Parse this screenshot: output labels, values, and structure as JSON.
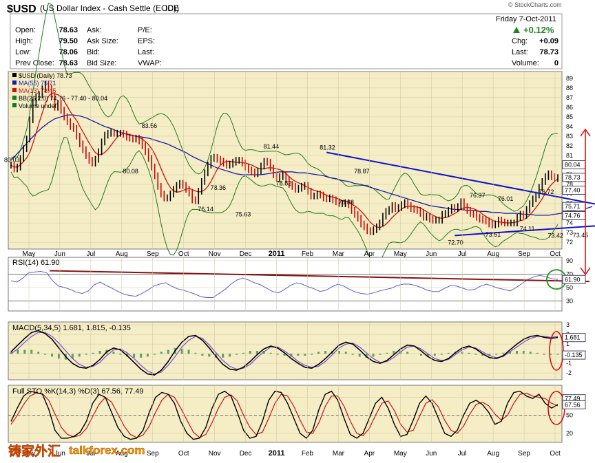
{
  "header": {
    "symbol": "$USD",
    "name": "(US Dollar Index - Cash Settle (EOD))",
    "exchange": "ICE",
    "copyright": "© StockCharts.com",
    "date": "Friday  7-Oct-2011",
    "change_pct": "+0.12%"
  },
  "quote_left": [
    {
      "label": "Open:",
      "value": "78.63"
    },
    {
      "label": "High:",
      "value": "79.50"
    },
    {
      "label": "Low:",
      "value": "78.06"
    },
    {
      "label": "Prev Close:",
      "value": "78.63"
    }
  ],
  "quote_mid": [
    {
      "label": "Ask:",
      "value": ""
    },
    {
      "label": "Ask Size:",
      "value": ""
    },
    {
      "label": "Bid:",
      "value": ""
    },
    {
      "label": "Bid Size:",
      "value": ""
    }
  ],
  "quote_mid2": [
    {
      "label": "P/E:",
      "value": ""
    },
    {
      "label": "EPS:",
      "value": ""
    },
    {
      "label": "Last:",
      "value": ""
    },
    {
      "label": "VWAP:",
      "value": ""
    }
  ],
  "quote_right": [
    {
      "label": "Chg:",
      "value": "+0.09"
    },
    {
      "label": "Last:",
      "value": "78.73"
    },
    {
      "label": "Volume:",
      "value": "0"
    }
  ],
  "watermark": {
    "cn": "铸家外汇",
    "en": "talkforex.com"
  },
  "colors": {
    "panel_bg": "#f4edc6",
    "price_bar": "#000000",
    "ma55": "#1a1aa8",
    "ma13": "#cc1010",
    "bb": "#1a7a1a",
    "trendline": "#1010cc",
    "annotation": "#e00000",
    "rsi_line": "#5a5ad0",
    "rsi_trend": "#8b1010",
    "rsi_circle": "#2a9a2a",
    "macd_line": "#000000",
    "macd_signal": "#7a4ad0",
    "macd_hist": "#5aa05a",
    "sto_k": "#000000",
    "sto_d": "#cc1010"
  },
  "chart_data": [
    {
      "type": "line",
      "panel": "price",
      "legend": [
        "$USD (Daily) 78.73",
        "MA(55) 75.71",
        "MA(13) 78.45",
        "BB(26,2.0) 74.76 - 77.40 - 80.04",
        "Volume undef"
      ],
      "x_labels": [
        "May",
        "Jun",
        "Jul",
        "Aug",
        "Sep",
        "Oct",
        "Nov",
        "Dec",
        "2011",
        "Feb",
        "Mar",
        "Apr",
        "May",
        "Jun",
        "Jul",
        "Aug",
        "Sep",
        "Oct"
      ],
      "y_ticks": [
        72,
        73,
        74,
        75,
        76,
        77,
        78,
        79,
        80,
        81,
        82,
        83,
        84,
        85,
        86,
        87,
        88,
        89
      ],
      "ylim": [
        71.3,
        89.7
      ],
      "right_value_tags": [
        "80.04",
        "78.73",
        "77.40",
        "75.71",
        "74.76"
      ],
      "annotations": [
        {
          "label": "80.03",
          "x": 0,
          "y": 80.03
        },
        {
          "label": "83.56",
          "x": 44,
          "y": 83.56
        },
        {
          "label": "80.08",
          "x": 38,
          "y": 80.08
        },
        {
          "label": "78.36",
          "x": 66,
          "y": 78.36
        },
        {
          "label": "76.14",
          "x": 62,
          "y": 76.14
        },
        {
          "label": "75.63",
          "x": 74,
          "y": 75.63
        },
        {
          "label": "81.44",
          "x": 83,
          "y": 81.44
        },
        {
          "label": "78.82",
          "x": 87,
          "y": 78.82
        },
        {
          "label": "81.32",
          "x": 101,
          "y": 81.32
        },
        {
          "label": "78.87",
          "x": 112,
          "y": 78.87
        },
        {
          "label": "76.88",
          "x": 107,
          "y": 76.88
        },
        {
          "label": "76.37",
          "x": 149,
          "y": 76.37
        },
        {
          "label": "76.01",
          "x": 158,
          "y": 76.01
        },
        {
          "label": "76.72",
          "x": 171,
          "y": 76.72
        },
        {
          "label": "75.45",
          "x": 181,
          "y": 75.45
        },
        {
          "label": "74.11",
          "x": 165,
          "y": 74.11
        },
        {
          "label": "73.51",
          "x": 154,
          "y": 73.51
        },
        {
          "label": "73.42",
          "x": 174,
          "y": 73.42
        },
        {
          "label": "73.45",
          "x": 182,
          "y": 73.45
        },
        {
          "label": "72.70",
          "x": 142,
          "y": 72.7
        },
        {
          "label": "79.8",
          "x": 198,
          "y": 79.8
        }
      ],
      "trendlines": [
        {
          "from": [
            101,
            81.32
          ],
          "to": [
            213,
            74.3
          ]
        },
        {
          "from": [
            142,
            72.7
          ],
          "to": [
            213,
            74.3
          ]
        }
      ],
      "close": [
        80.0,
        79.6,
        79.8,
        80.7,
        81.7,
        82.7,
        84.7,
        86.5,
        87.1,
        87.3,
        87.9,
        88.4,
        88.0,
        87.1,
        86.0,
        86.4,
        85.7,
        85.0,
        84.5,
        84.0,
        83.8,
        83.0,
        82.2,
        81.6,
        81.0,
        80.5,
        80.2,
        80.6,
        81.4,
        82.4,
        83.1,
        83.3,
        83.4,
        83.3,
        83.3,
        83.3,
        83.2,
        82.9,
        82.8,
        82.7,
        82.8,
        82.5,
        82.0,
        81.4,
        80.7,
        79.8,
        78.9,
        77.8,
        77.0,
        76.6,
        76.6,
        77.0,
        77.5,
        77.9,
        78.1,
        77.9,
        77.5,
        77.1,
        76.4,
        76.3,
        77.3,
        78.3,
        79.2,
        80.0,
        80.7,
        80.8,
        80.6,
        80.4,
        80.2,
        80.0,
        80.1,
        80.3,
        80.5,
        80.5,
        80.2,
        79.8,
        79.5,
        79.3,
        79.1,
        79.4,
        79.9,
        80.4,
        80.3,
        79.7,
        79.0,
        78.6,
        78.8,
        79.0,
        78.5,
        78.0,
        77.8,
        77.5,
        77.6,
        77.8,
        77.9,
        77.3,
        76.8,
        76.8,
        77.0,
        76.9,
        76.6,
        76.5,
        76.6,
        76.4,
        76.2,
        76.0,
        76.0,
        76.1,
        75.9,
        75.3,
        74.9,
        74.5,
        73.9,
        73.6,
        73.2,
        73.1,
        73.3,
        73.6,
        74.0,
        74.7,
        75.2,
        75.4,
        75.8,
        75.5,
        75.6,
        75.9,
        76.1,
        75.8,
        75.5,
        75.4,
        75.3,
        75.0,
        74.6,
        74.7,
        74.4,
        74.3,
        74.3,
        74.3,
        74.9,
        75.0,
        75.3,
        75.6,
        75.5,
        75.7,
        76.2,
        75.7,
        75.3,
        75.0,
        74.9,
        74.6,
        74.4,
        74.3,
        74.2,
        73.9,
        73.8,
        73.9,
        74.3,
        74.1,
        74.0,
        74.0,
        74.0,
        74.0,
        74.6,
        74.9,
        74.8,
        75.4,
        76.0,
        76.5,
        76.9,
        77.7,
        78.3,
        78.8,
        79.1,
        78.8,
        78.6,
        78.7
      ],
      "ma55": [
        80.5,
        81.2,
        81.9,
        82.6,
        83.3,
        83.9,
        84.4,
        84.8,
        85.0,
        85.2,
        85.2,
        85.1,
        84.9,
        84.6,
        84.3,
        84.0,
        83.8,
        83.5,
        83.3,
        83.1,
        83.0,
        82.9,
        82.8,
        82.6,
        82.4,
        82.2,
        81.9,
        81.6,
        81.3,
        80.9,
        80.6,
        80.3,
        80.0,
        79.7,
        79.5,
        79.3,
        79.1,
        79.0,
        79.0,
        79.0,
        79.0,
        79.1,
        79.2,
        79.3,
        79.3,
        79.3,
        79.2,
        79.2,
        79.1,
        79.0,
        78.9,
        78.7,
        78.6,
        78.4,
        78.3,
        78.1,
        78.0,
        77.8,
        77.6,
        77.4,
        77.2,
        77.0,
        76.8,
        76.6,
        76.4,
        76.2,
        76.0,
        75.8,
        75.7,
        75.6,
        75.5,
        75.4,
        75.4,
        75.3,
        75.3,
        75.2,
        75.2,
        75.1,
        75.1,
        75.0,
        75.0,
        75.0,
        74.9,
        74.9,
        74.8,
        74.8,
        74.8,
        74.9,
        75.0,
        75.1,
        75.2,
        75.4,
        75.5,
        75.7
      ],
      "sample_every": 2
    },
    {
      "type": "line",
      "panel": "rsi",
      "legend": "RSI(14) 61.90",
      "y_ticks": [
        30,
        50,
        70,
        90
      ],
      "ylim": [
        15,
        95
      ],
      "right_value_tag": "61.90",
      "values": [
        60,
        58,
        64,
        72,
        73,
        74,
        72,
        60,
        52,
        50,
        47,
        43,
        41,
        45,
        54,
        58,
        53,
        49,
        44,
        40,
        38,
        37,
        41,
        46,
        52,
        55,
        57,
        52,
        48,
        46,
        43,
        40,
        36,
        35,
        35,
        41,
        47,
        55,
        61,
        64,
        61,
        57,
        54,
        49,
        44,
        42,
        47,
        53,
        57,
        55,
        51,
        48,
        44,
        46,
        51,
        55,
        52,
        47,
        43,
        41,
        40,
        42,
        45,
        47,
        49,
        53,
        55,
        55,
        53,
        50,
        46,
        44,
        44,
        49,
        53,
        52,
        49,
        46,
        47,
        52,
        55,
        52,
        49,
        47,
        45,
        50,
        56,
        62,
        66,
        68,
        66,
        63,
        62
      ]
    },
    {
      "type": "line",
      "panel": "macd",
      "legend": "MACD(5,34,5) 1.681, 1.815, -0.135",
      "y_ticks": [
        -2,
        -1,
        0,
        1,
        2,
        3
      ],
      "ylim": [
        -2.7,
        3.3
      ],
      "right_value_tags": [
        "1.681",
        "-0.135"
      ],
      "macd": [
        0.2,
        0.9,
        1.6,
        2.2,
        2.4,
        2.1,
        1.5,
        0.6,
        -0.3,
        -1.0,
        -1.4,
        -1.5,
        -1.2,
        -0.6,
        0.2,
        0.6,
        0.4,
        -0.2,
        -0.9,
        -1.6,
        -2.1,
        -2.2,
        -1.7,
        -0.8,
        0.3,
        1.2,
        1.8,
        1.9,
        1.4,
        0.6,
        -0.3,
        -1.1,
        -1.6,
        -1.7,
        -1.4,
        -0.8,
        -0.1,
        0.5,
        0.8,
        0.6,
        0.1,
        -0.5,
        -1.0,
        -1.4,
        -1.5,
        -1.1,
        -0.5,
        0.2,
        0.9,
        1.2,
        1.0,
        0.4,
        -0.3,
        -0.8,
        -1.0,
        -0.7,
        -0.1,
        0.5,
        0.9,
        0.8,
        0.3,
        -0.3,
        -0.7,
        -0.8,
        -0.5,
        0.1,
        0.6,
        0.8,
        0.5,
        0.0,
        -0.4,
        -0.5,
        -0.2,
        0.4,
        1.0,
        1.5,
        1.8,
        1.9,
        1.7,
        1.6,
        1.7
      ],
      "signal": [
        0.0,
        0.5,
        1.2,
        1.8,
        2.2,
        2.2,
        1.8,
        1.1,
        0.3,
        -0.5,
        -1.1,
        -1.4,
        -1.3,
        -0.9,
        -0.2,
        0.4,
        0.5,
        0.1,
        -0.5,
        -1.2,
        -1.8,
        -2.1,
        -1.9,
        -1.2,
        -0.3,
        0.7,
        1.4,
        1.8,
        1.6,
        0.9,
        0.1,
        -0.7,
        -1.3,
        -1.6,
        -1.5,
        -1.1,
        -0.4,
        0.2,
        0.7,
        0.7,
        0.3,
        -0.2,
        -0.8,
        -1.2,
        -1.4,
        -1.3,
        -0.8,
        -0.1,
        0.6,
        1.0,
        1.1,
        0.7,
        0.1,
        -0.5,
        -0.9,
        -0.8,
        -0.4,
        0.2,
        0.7,
        0.8,
        0.5,
        0.0,
        -0.5,
        -0.7,
        -0.6,
        -0.1,
        0.4,
        0.7,
        0.6,
        0.2,
        -0.2,
        -0.4,
        -0.3,
        0.2,
        0.7,
        1.2,
        1.6,
        1.8,
        1.8,
        1.7,
        1.8
      ]
    },
    {
      "type": "line",
      "panel": "stochastic",
      "legend": "Full STO %K(14,3) %D(3) 67.56, 77.49",
      "y_ticks": [
        20,
        50,
        80
      ],
      "ylim": [
        5,
        100
      ],
      "right_value_tags": [
        "77.49",
        "67.56"
      ],
      "k": [
        40,
        62,
        82,
        90,
        88,
        85,
        60,
        25,
        12,
        12,
        15,
        22,
        40,
        70,
        85,
        80,
        55,
        30,
        15,
        10,
        12,
        25,
        55,
        80,
        88,
        85,
        70,
        40,
        20,
        10,
        12,
        30,
        62,
        85,
        90,
        82,
        55,
        25,
        12,
        15,
        40,
        75,
        90,
        88,
        70,
        45,
        20,
        12,
        25,
        60,
        85,
        90,
        75,
        45,
        18,
        12,
        20,
        45,
        70,
        80,
        62,
        35,
        15,
        18,
        42,
        70,
        82,
        70,
        45,
        20,
        15,
        25,
        50,
        70,
        75,
        68,
        55,
        35,
        40,
        70,
        88,
        90,
        82,
        78,
        85,
        70,
        62,
        68
      ],
      "d": [
        35,
        50,
        68,
        82,
        87,
        86,
        75,
        52,
        30,
        18,
        14,
        17,
        28,
        48,
        68,
        80,
        72,
        52,
        32,
        18,
        13,
        17,
        32,
        55,
        75,
        85,
        80,
        62,
        42,
        22,
        13,
        18,
        38,
        62,
        80,
        84,
        74,
        50,
        30,
        18,
        22,
        45,
        70,
        85,
        82,
        65,
        42,
        22,
        20,
        38,
        65,
        82,
        82,
        65,
        40,
        20,
        16,
        28,
        50,
        70,
        74,
        58,
        35,
        22,
        25,
        48,
        70,
        76,
        64,
        42,
        25,
        20,
        32,
        52,
        68,
        72,
        66,
        52,
        42,
        50,
        70,
        85,
        87,
        82,
        80,
        78,
        70,
        66
      ]
    }
  ]
}
